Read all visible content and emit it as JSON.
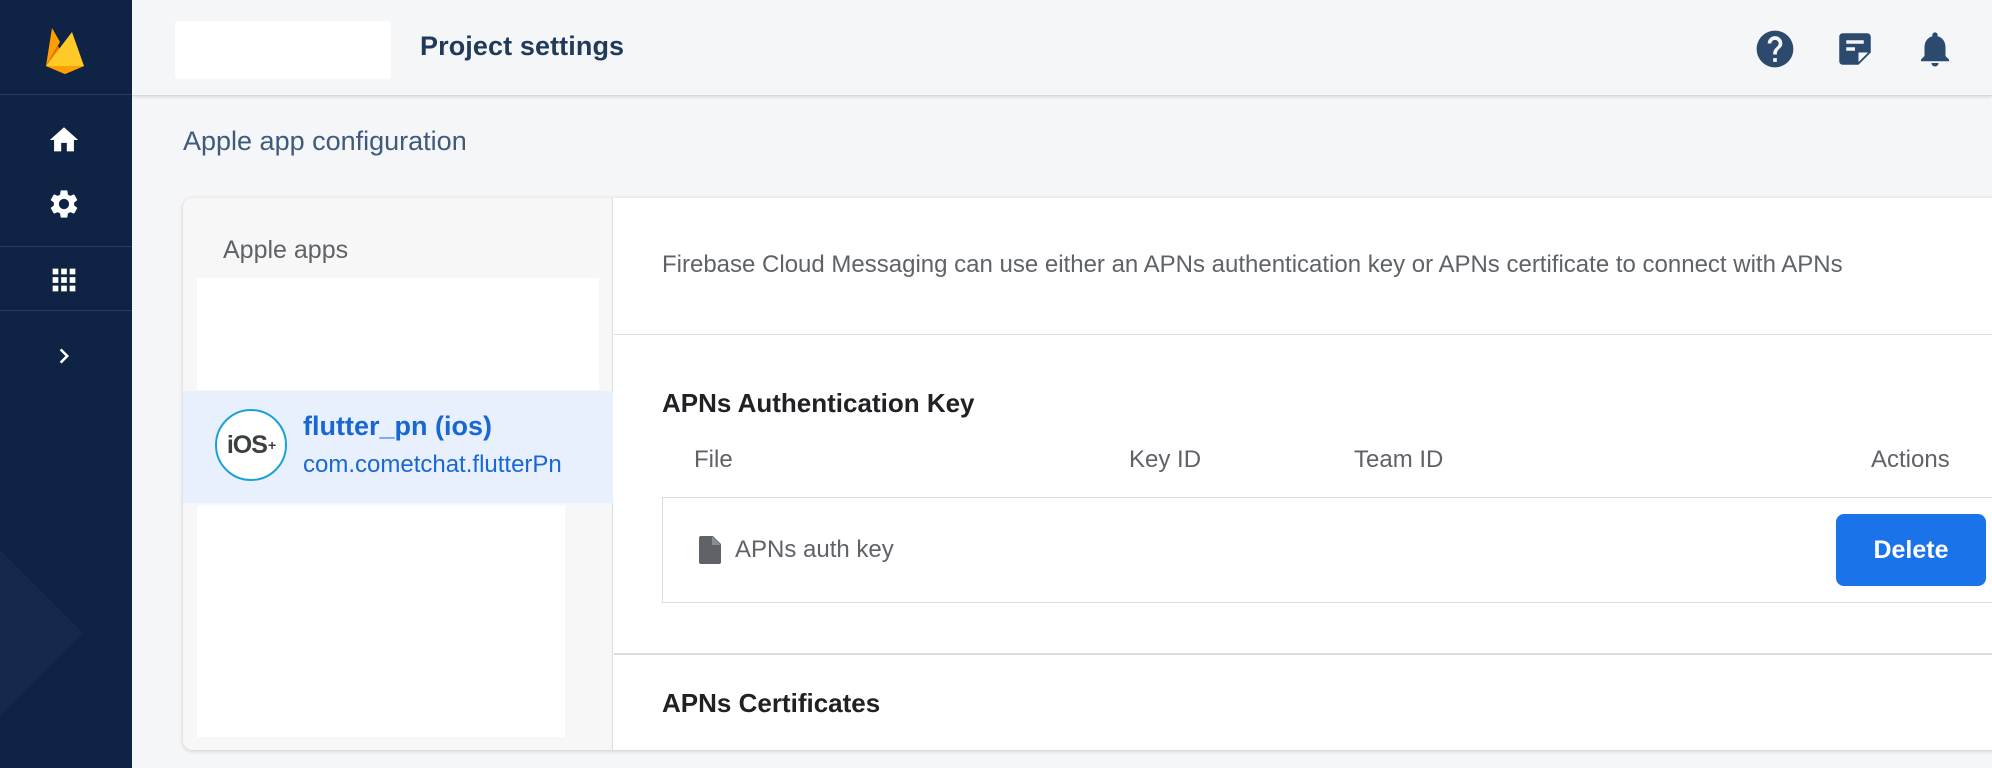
{
  "header": {
    "title": "Project settings",
    "icons": [
      "help-icon",
      "feedback-icon",
      "notifications-icon"
    ]
  },
  "sidebar": {
    "icons": [
      "firebase-logo",
      "home-icon",
      "settings-icon",
      "apps-grid-icon",
      "chevron-right-icon"
    ]
  },
  "main": {
    "section_title": "Apple app configuration",
    "apps_panel": {
      "label": "Apple apps",
      "apps": [
        {
          "badge": "iOS",
          "badge_sup": "+",
          "name": "flutter_pn (ios)",
          "bundle_id": "com.cometchat.flutterPn",
          "selected": true
        }
      ]
    },
    "detail": {
      "note": "Firebase Cloud Messaging can use either an APNs authentication key or APNs certificate to connect with APNs",
      "auth_key": {
        "title": "APNs Authentication Key",
        "columns": [
          "File",
          "Key ID",
          "Team ID",
          "Actions"
        ],
        "rows": [
          {
            "file": "APNs auth key",
            "key_id": "",
            "team_id": "",
            "action_label": "Delete"
          }
        ]
      },
      "certificates": {
        "title": "APNs Certificates"
      }
    }
  },
  "colors": {
    "sidebar_bg": "#0f2344",
    "accent": "#1a73e8",
    "selected_bg": "#e7f0fc"
  }
}
